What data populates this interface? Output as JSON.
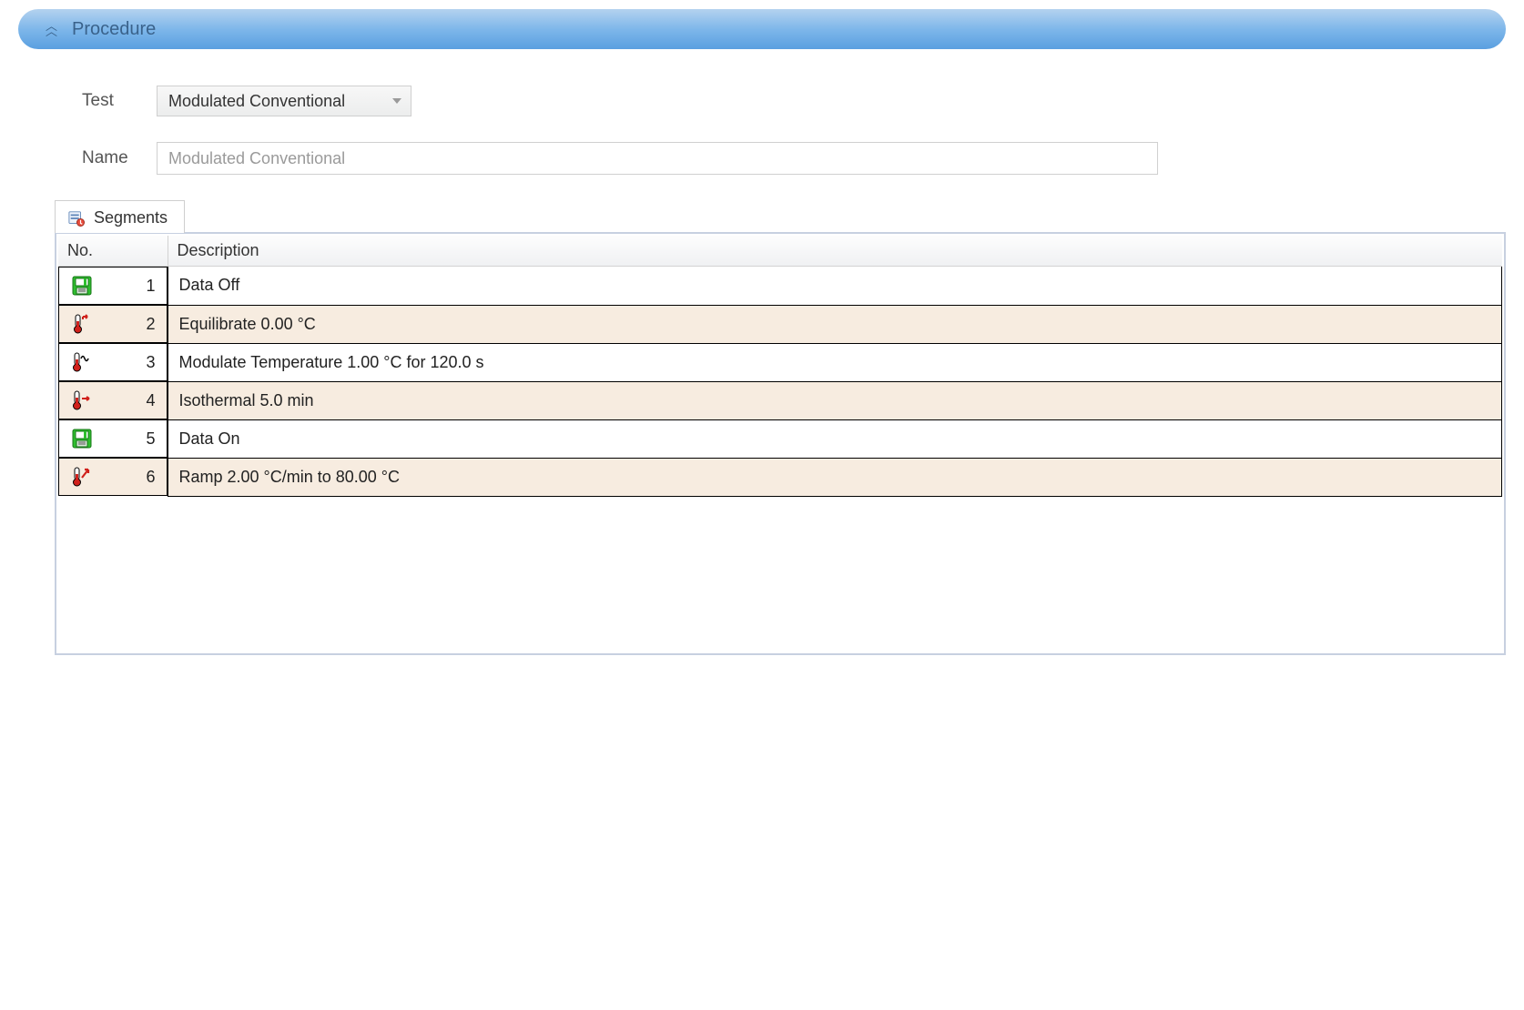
{
  "panel": {
    "title": "Procedure"
  },
  "form": {
    "test_label": "Test",
    "test_value": "Modulated Conventional",
    "name_label": "Name",
    "name_value": "Modulated Conventional"
  },
  "tab": {
    "label": "Segments",
    "icon": "segments-icon"
  },
  "table": {
    "header_no": "No.",
    "header_desc": "Description",
    "rows": [
      {
        "no": "1",
        "icon": "disk-icon",
        "desc": "Data Off"
      },
      {
        "no": "2",
        "icon": "thermo-equil-icon",
        "desc": "Equilibrate 0.00 °C"
      },
      {
        "no": "3",
        "icon": "thermo-modulate-icon",
        "desc": "Modulate Temperature 1.00 °C for 120.0 s"
      },
      {
        "no": "4",
        "icon": "thermo-iso-icon",
        "desc": "Isothermal 5.0 min"
      },
      {
        "no": "5",
        "icon": "disk-icon",
        "desc": "Data On"
      },
      {
        "no": "6",
        "icon": "thermo-ramp-icon",
        "desc": "Ramp 2.00 °C/min to 80.00 °C"
      }
    ]
  }
}
